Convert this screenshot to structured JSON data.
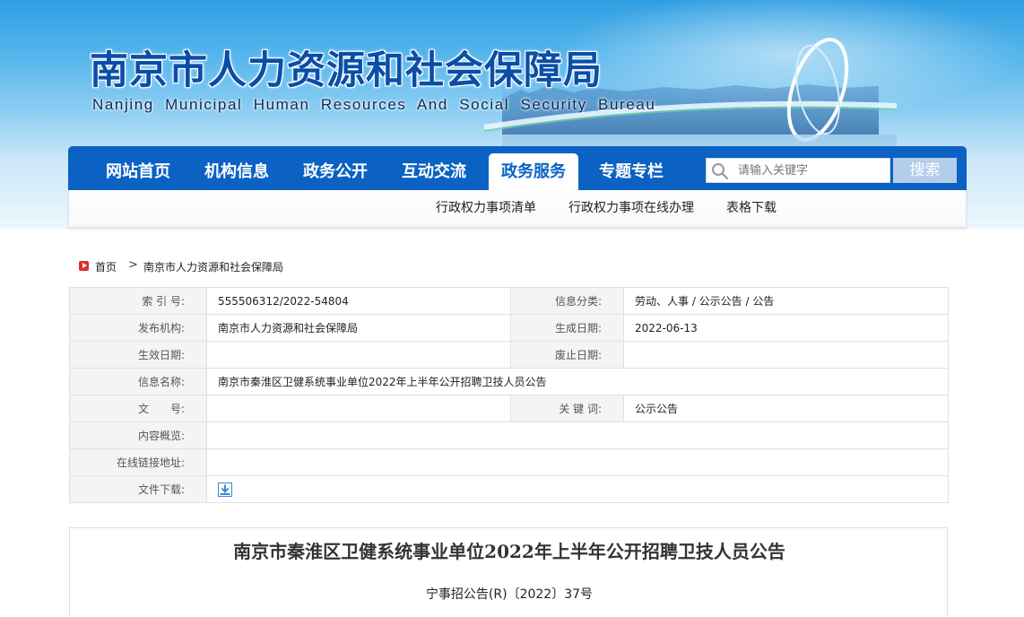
{
  "header": {
    "title": "南京市人力资源和社会保障局",
    "subtitle": "Nanjing Municipal Human Resources And Social Security Bureau"
  },
  "nav": {
    "items": [
      {
        "label": "网站首页"
      },
      {
        "label": "机构信息"
      },
      {
        "label": "政务公开"
      },
      {
        "label": "互动交流"
      },
      {
        "label": "政务服务"
      },
      {
        "label": "专题专栏"
      }
    ],
    "active_index": 4,
    "search_placeholder": "请输入关键字",
    "search_button": "搜索"
  },
  "subnav": {
    "items": [
      {
        "label": "行政权力事项清单"
      },
      {
        "label": "行政权力事项在线办理"
      },
      {
        "label": "表格下载"
      }
    ]
  },
  "breadcrumb": {
    "home": "首页",
    "separator": ">",
    "current": "南京市人力资源和社会保障局"
  },
  "meta": {
    "index_label": "索 引 号:",
    "index_value": "555506312/2022-54804",
    "category_label": "信息分类:",
    "category_value": "劳动、人事 / 公示公告 / 公告",
    "publisher_label": "发布机构:",
    "publisher_value": "南京市人力资源和社会保障局",
    "created_label": "生成日期:",
    "created_value": "2022-06-13",
    "effective_label": "生效日期:",
    "effective_value": "",
    "repeal_label": "废止日期:",
    "repeal_value": "",
    "name_label": "信息名称:",
    "name_value": "南京市秦淮区卫健系统事业单位2022年上半年公开招聘卫技人员公告",
    "docno_label": "文　　号:",
    "docno_value": "",
    "keyword_label": "关 键 词:",
    "keyword_value": "公示公告",
    "summary_label": "内容概览:",
    "summary_value": "",
    "link_label": "在线链接地址:",
    "link_value": "",
    "download_label": "文件下载:"
  },
  "article": {
    "title": "南京市秦淮区卫健系统事业单位2022年上半年公开招聘卫技人员公告",
    "doc_number": "宁事招公告(R)〔2022〕37号"
  },
  "colors": {
    "nav_blue": "#0b62c3",
    "title_blue": "#0a4ea8",
    "search_button": "#b3cdea",
    "breadcrumb_icon": "#d9312b"
  }
}
